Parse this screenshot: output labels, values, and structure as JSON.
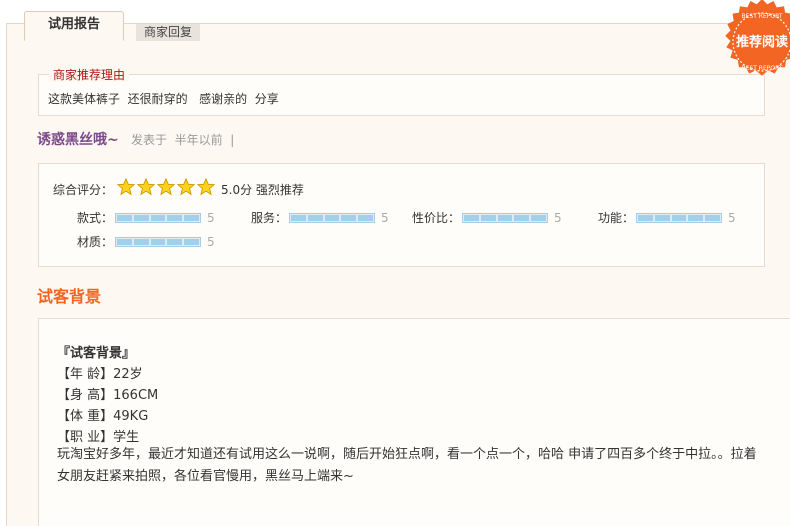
{
  "tabs": {
    "report": "试用报告",
    "merchant_reply": "商家回复"
  },
  "badge": {
    "top_text": "BEST REPORT",
    "main_text": "推荐阅读",
    "bottom_text": "BEST REPORT",
    "color": "#f26522"
  },
  "reason": {
    "title": "商家推荐理由",
    "text": "这款美体裤子  还很耐穿的   感谢亲的  分享"
  },
  "author": {
    "name": "诱惑黑丝哦~",
    "meta": "发表于  半年以前  |"
  },
  "rating": {
    "overall_label": "综合评分：",
    "stars": 5,
    "overall_text": "5.0分 强烈推荐",
    "items": [
      {
        "label": "款式：",
        "value": "5",
        "fraction": 1.0
      },
      {
        "label": "服务：",
        "value": "5",
        "fraction": 1.0
      },
      {
        "label": "性价比：",
        "value": "5",
        "fraction": 1.0
      },
      {
        "label": "功能：",
        "value": "5",
        "fraction": 1.0
      },
      {
        "label": "材质：",
        "value": "5",
        "fraction": 1.0
      }
    ]
  },
  "background": {
    "title": "试客背景",
    "heading": "『试客背景』",
    "age": "【年 龄】22岁",
    "height": "【身 高】166CM",
    "weight": "【体 重】49KG",
    "job": "【职 业】学生",
    "paragraph": "玩淘宝好多年，最近才知道还有试用这么一说啊，随后开始狂点啊，看一个点一个，哈哈 申请了四百多个终于中拉。。拉着女朋友赶紧来拍照，各位看官慢用，黑丝马上端来~"
  }
}
